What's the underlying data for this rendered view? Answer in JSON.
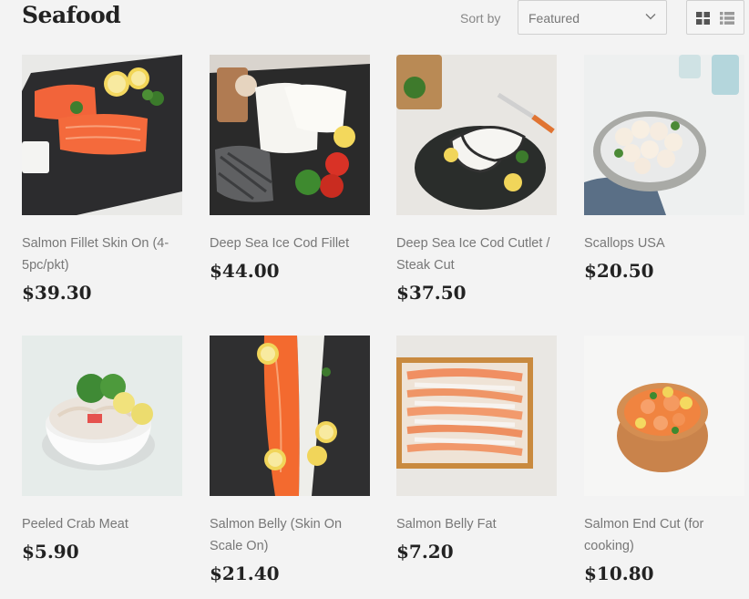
{
  "page": {
    "title": "Seafood"
  },
  "sort": {
    "label": "Sort by",
    "selected": "Featured"
  },
  "view": {
    "grid_icon": "grid-icon",
    "list_icon": "list-icon"
  },
  "products": [
    {
      "name": "Salmon Fillet Skin On (4-5pc/pkt)",
      "price": "$39.30"
    },
    {
      "name": "Deep Sea Ice Cod Fillet",
      "price": "$44.00"
    },
    {
      "name": "Deep Sea Ice Cod Cutlet / Steak Cut",
      "price": "$37.50"
    },
    {
      "name": "Scallops USA",
      "price": "$20.50"
    },
    {
      "name": "Peeled Crab Meat",
      "price": "$5.90"
    },
    {
      "name": "Salmon Belly (Skin On Scale On)",
      "price": "$21.40"
    },
    {
      "name": "Salmon Belly Fat",
      "price": "$7.20"
    },
    {
      "name": "Salmon End Cut (for cooking)",
      "price": "$10.80"
    }
  ]
}
